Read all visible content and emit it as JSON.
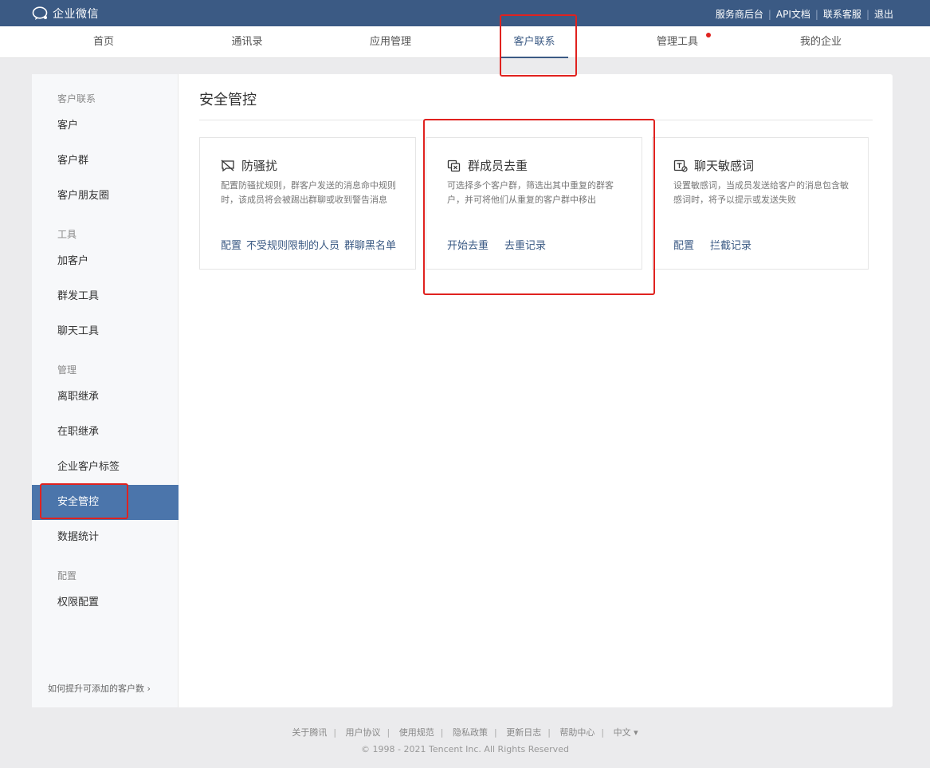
{
  "brand": {
    "name": "企业微信"
  },
  "top_links": [
    "服务商后台",
    "API文档",
    "联系客服",
    "退出"
  ],
  "nav": {
    "items": [
      "首页",
      "通讯录",
      "应用管理",
      "客户联系",
      "管理工具",
      "我的企业"
    ],
    "active": "客户联系"
  },
  "sidebar": {
    "groups": [
      "客户联系",
      "工具",
      "管理",
      "配置"
    ],
    "items": [
      "客户",
      "客户群",
      "客户朋友圈",
      "加客户",
      "群发工具",
      "聊天工具",
      "离职继承",
      "在职继承",
      "企业客户标签",
      "安全管控",
      "数据统计",
      "权限配置"
    ],
    "active": "安全管控",
    "help": "如何提升可添加的客户数"
  },
  "page": {
    "title": "安全管控"
  },
  "cards": [
    {
      "title": "防骚扰",
      "icon": "anti-harass-icon",
      "desc": "配置防骚扰规则，群客户发送的消息命中规则时，该成员将会被踢出群聊或收到警告消息",
      "links": [
        "配置",
        "不受规则限制的人员",
        "群聊黑名单"
      ]
    },
    {
      "title": "群成员去重",
      "icon": "dedupe-icon",
      "desc": "可选择多个客户群，筛选出其中重复的群客户，并可将他们从重复的客户群中移出",
      "links": [
        "开始去重",
        "去重记录"
      ]
    },
    {
      "title": "聊天敏感词",
      "icon": "sensitive-word-icon",
      "desc": "设置敏感词，当成员发送给客户的消息包含敏感词时，将予以提示或发送失败",
      "links": [
        "配置",
        "拦截记录"
      ]
    }
  ],
  "footer": {
    "links": [
      "关于腾讯",
      "用户协议",
      "使用规范",
      "隐私政策",
      "更新日志",
      "帮助中心",
      "中文 ▾"
    ],
    "copyright": "© 1998 - 2021 Tencent Inc. All Rights Reserved"
  },
  "colors": {
    "topbar": "#3b5a84",
    "accent": "#3b5a84",
    "sidebar_active": "#4b75ab",
    "highlight": "#e0221f"
  }
}
